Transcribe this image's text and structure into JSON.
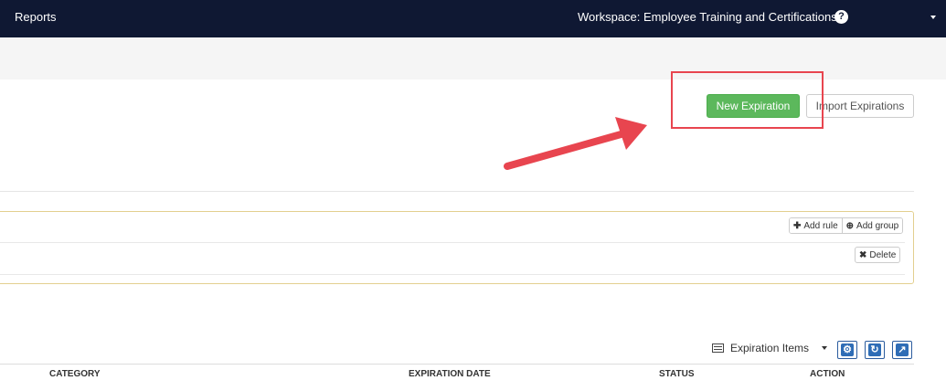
{
  "topnav": {
    "reports_label": "Reports",
    "workspace_label": "Workspace: Employee Training and Certifications",
    "help_glyph": "?",
    "background_color": "#0f1833"
  },
  "actions": {
    "new_expiration_label": "New Expiration",
    "import_expirations_label": "Import Expirations",
    "new_button_color": "#5cb85c"
  },
  "annotation": {
    "highlight_color": "#e8454f"
  },
  "query_builder": {
    "add_rule_label": "Add rule",
    "add_group_label": "Add group",
    "delete_label": "Delete",
    "add_rule_icon": "plus-icon",
    "add_group_icon": "plus-circle-icon",
    "delete_icon": "x-icon"
  },
  "table": {
    "view_selected": "Expiration Items",
    "columns": [
      "CATEGORY",
      "EXPIRATION DATE",
      "STATUS",
      "ACTION"
    ],
    "toolbar_icons": [
      "gear-icon",
      "refresh-icon",
      "export-icon"
    ]
  }
}
